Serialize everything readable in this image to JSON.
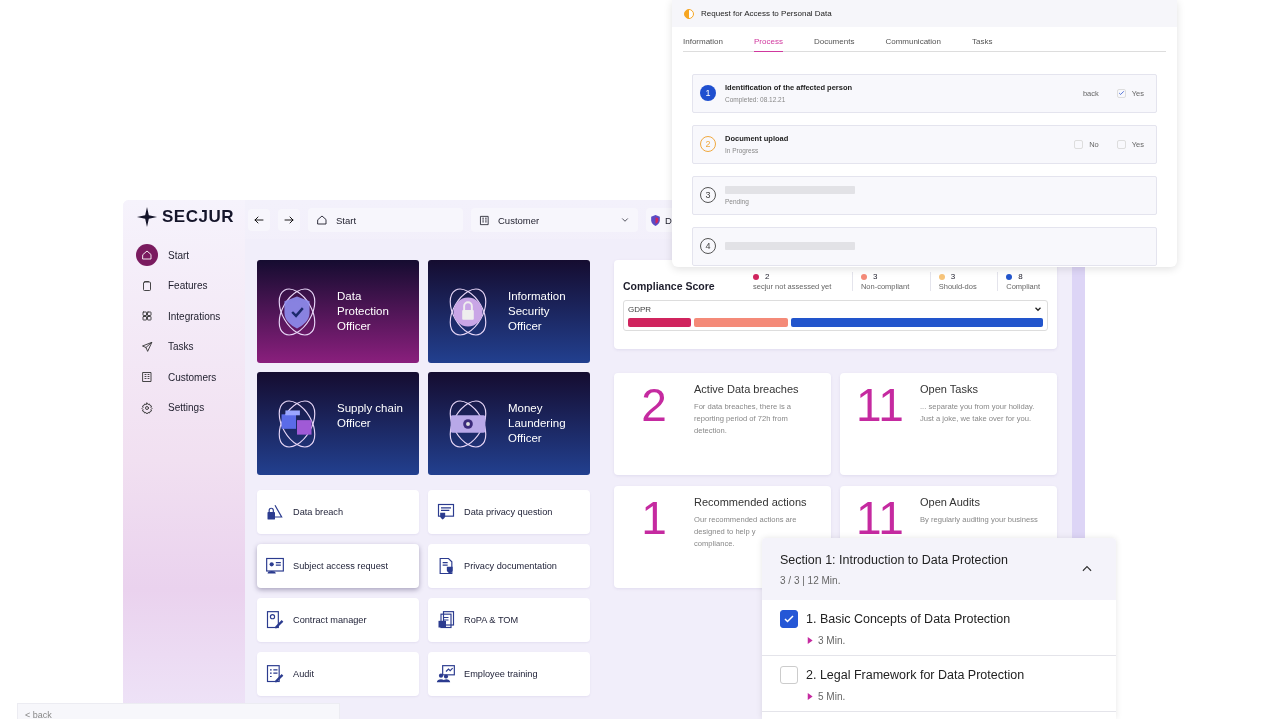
{
  "app": {
    "logo": "SECJUR",
    "nav": [
      {
        "label": "Start",
        "selected": true
      },
      {
        "label": "Features",
        "selected": false
      },
      {
        "label": "Integrations",
        "selected": false
      },
      {
        "label": "Tasks",
        "selected": false
      },
      {
        "label": "Customers",
        "selected": false
      },
      {
        "label": "Settings",
        "selected": false
      }
    ],
    "toolbar": {
      "location": "Start",
      "customer": "Customer",
      "account": "D"
    },
    "role_tiles": [
      {
        "label": "Data Protection Officer",
        "color": "#8a1f7d"
      },
      {
        "label": "Information Security Officer",
        "color": "#22408f"
      },
      {
        "label": "Supply chain Officer",
        "color": "#22408f"
      },
      {
        "label": "Money Laundering Officer",
        "color": "#22408f"
      }
    ],
    "action_tiles": [
      {
        "label": "Data breach",
        "hovered": false
      },
      {
        "label": "Data privacy question",
        "hovered": false
      },
      {
        "label": "Subject access request",
        "hovered": true
      },
      {
        "label": "Privacy documentation",
        "hovered": false
      },
      {
        "label": "Contract manager",
        "hovered": false
      },
      {
        "label": "RoPA & TOM",
        "hovered": false
      },
      {
        "label": "Audit",
        "hovered": false
      },
      {
        "label": "Employee training",
        "hovered": false
      }
    ],
    "compliance": {
      "title": "Compliance Score",
      "framework": "GDPR",
      "legend": [
        {
          "count": "2",
          "label": "secjur not assessed yet",
          "color": "#d0245e",
          "in_bar": true
        },
        {
          "count": "3",
          "label": "Non-compliant",
          "color": "#f48a78",
          "in_bar": true
        },
        {
          "count": "3",
          "label": "Should-dos",
          "color": "#f7c47a",
          "in_bar": false
        },
        {
          "count": "8",
          "label": "Compliant",
          "color": "#2255cc",
          "in_bar": true
        }
      ]
    },
    "stats": [
      {
        "value": "2",
        "title": "Active Data breaches",
        "lines": [
          "For data breaches, there is a",
          "reporting period of 72h from",
          "detection."
        ]
      },
      {
        "value": "11",
        "title": "Open Tasks",
        "lines": [
          "... separate you from your holiday.",
          "Just a joke, we take over for you."
        ]
      },
      {
        "value": "1",
        "title": "Recommended actions",
        "lines": [
          "Our recommended actions are",
          "designed to help y",
          "compliance."
        ]
      },
      {
        "value": "11",
        "title": "Open Audits",
        "lines": [
          "By regularly auditing your business"
        ]
      }
    ]
  },
  "request_panel": {
    "title": "Request for Access to Personal Data",
    "tabs": [
      {
        "label": "Information",
        "selected": false
      },
      {
        "label": "Process",
        "selected": true
      },
      {
        "label": "Documents",
        "selected": false
      },
      {
        "label": "Communication",
        "selected": false
      },
      {
        "label": "Tasks",
        "selected": false
      }
    ],
    "steps": [
      {
        "number": "1",
        "kind": "done",
        "title": "Identification of the affected person",
        "subtitle": "Completed: 08.12.21",
        "link": "back",
        "options": [
          {
            "label": "Yes",
            "checked": true
          }
        ]
      },
      {
        "number": "2",
        "kind": "active",
        "title": "Document upload",
        "subtitle": "In Progress",
        "options": [
          {
            "label": "No",
            "checked": false
          },
          {
            "label": "Yes",
            "checked": false
          }
        ]
      },
      {
        "number": "3",
        "kind": "pending",
        "subtitle": "Pending"
      },
      {
        "number": "4",
        "kind": "pending"
      }
    ]
  },
  "course_panel": {
    "title": "Section 1: Introduction to Data Protection",
    "progress": "3 / 3 | 12 Min.",
    "expanded": true,
    "lessons": [
      {
        "title": "1. Basic Concepts of Data Protection",
        "duration": "3 Min.",
        "checked": true
      },
      {
        "title": "2. Legal Framework for Data Protection",
        "duration": "5 Min.",
        "checked": false
      }
    ]
  },
  "footer_bar": {
    "back": "< back"
  }
}
